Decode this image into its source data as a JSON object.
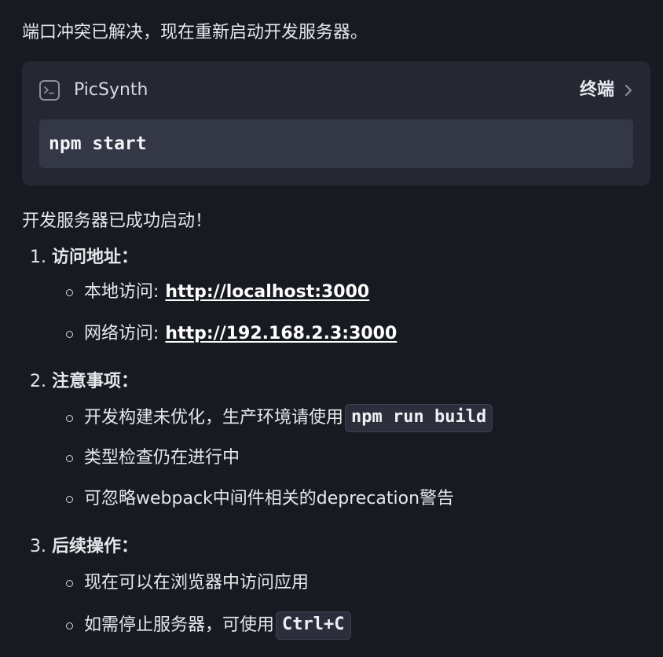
{
  "intro_text": "端口冲突已解决，现在重新启动开发服务器。",
  "terminal": {
    "app_name": "PicSynth",
    "open_label": "终端",
    "command": "npm start",
    "icon": "terminal-icon"
  },
  "success_text": "开发服务器已成功启动！",
  "steps": [
    {
      "number": "1.",
      "title": "访问地址：",
      "items": [
        {
          "prefix": "本地访问:",
          "link": "http://localhost:3000"
        },
        {
          "prefix": "网络访问:",
          "link": "http://192.168.2.3:3000"
        }
      ]
    },
    {
      "number": "2.",
      "title": "注意事项：",
      "items": [
        {
          "text": "开发构建未优化，生产环境请使用",
          "code": "npm run build"
        },
        {
          "text": "类型检查仍在进行中"
        },
        {
          "text": "可忽略webpack中间件相关的deprecation警告"
        }
      ]
    },
    {
      "number": "3.",
      "title": "后续操作：",
      "items": [
        {
          "text": "现在可以在浏览器中访问应用"
        },
        {
          "text": "如需停止服务器，可使用",
          "code": "Ctrl+C"
        }
      ]
    }
  ]
}
